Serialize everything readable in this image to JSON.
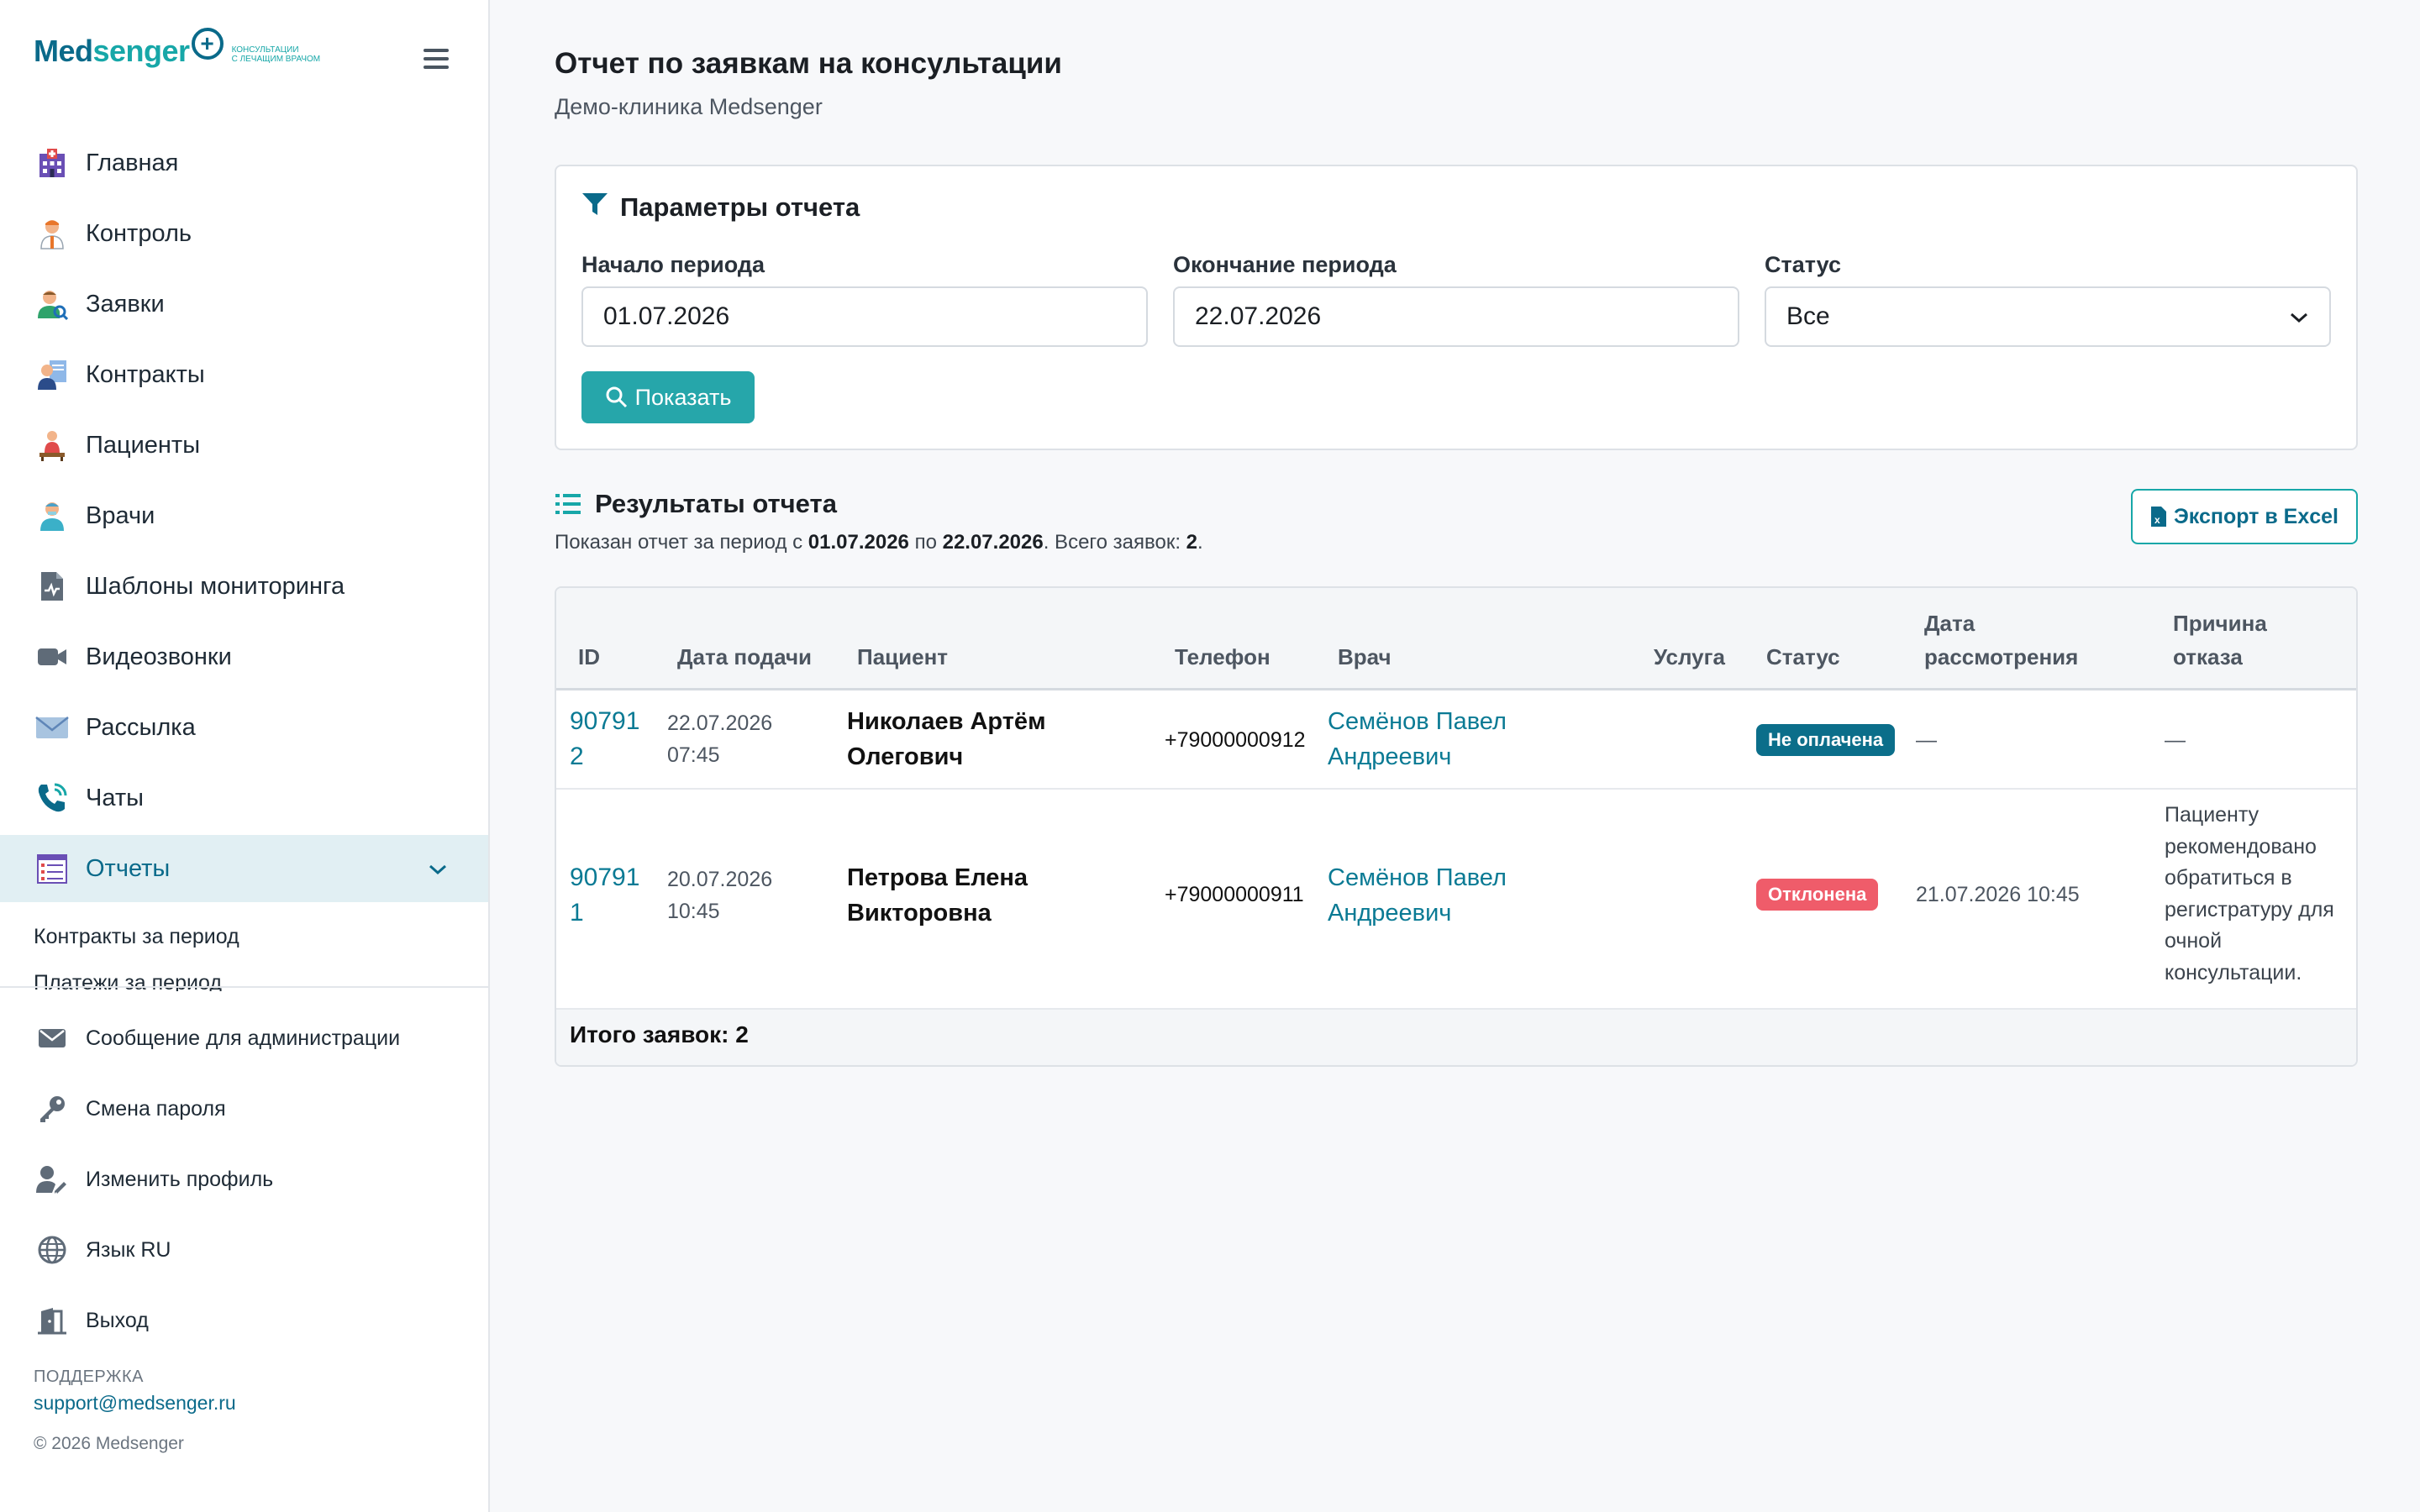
{
  "brand": {
    "name_part1": "Med",
    "name_part2": "senger",
    "tagline_line1": "консультации",
    "tagline_line2": "с лечащим врачом"
  },
  "sidebar": {
    "items": [
      {
        "label": "Главная",
        "icon": "hospital-icon"
      },
      {
        "label": "Контроль",
        "icon": "doctor-icon"
      },
      {
        "label": "Заявки",
        "icon": "user-search-icon"
      },
      {
        "label": "Контракты",
        "icon": "contract-icon"
      },
      {
        "label": "Пациенты",
        "icon": "patient-icon"
      },
      {
        "label": "Врачи",
        "icon": "physician-icon"
      },
      {
        "label": "Шаблоны мониторинга",
        "icon": "template-file-icon"
      },
      {
        "label": "Видеозвонки",
        "icon": "video-camera-icon"
      },
      {
        "label": "Рассылка",
        "icon": "envelope-icon"
      },
      {
        "label": "Чаты",
        "icon": "phone-chat-icon"
      }
    ],
    "active_item": {
      "label": "Отчеты",
      "icon": "report-checklist-icon"
    },
    "sub_items": [
      "Контракты за период",
      "Платежи за период"
    ],
    "bottom_items": [
      {
        "label": "Сообщение для администрации",
        "icon": "envelope-icon"
      },
      {
        "label": "Смена пароля",
        "icon": "key-icon"
      },
      {
        "label": "Изменить профиль",
        "icon": "user-edit-icon"
      },
      {
        "label": "Язык RU",
        "icon": "globe-icon"
      },
      {
        "label": "Выход",
        "icon": "exit-door-icon"
      }
    ],
    "support_label": "ПОДДЕРЖКА",
    "support_email": "support@medsenger.ru",
    "copyright": "© 2026 Medsenger"
  },
  "header": {
    "title": "Отчет по заявкам на консультации",
    "subtitle": "Демо-клиника Medsenger"
  },
  "params": {
    "title": "Параметры отчета",
    "start_label": "Начало периода",
    "start_value": "01.07.2026",
    "end_label": "Окончание периода",
    "end_value": "22.07.2026",
    "status_label": "Статус",
    "status_value": "Все",
    "show_button": "Показать"
  },
  "results": {
    "title": "Результаты отчета",
    "summary_prefix": "Показан отчет за период с ",
    "summary_from": "01.07.2026",
    "summary_mid": " по ",
    "summary_to": "22.07.2026",
    "summary_count_label": ". Всего заявок: ",
    "summary_count": "2",
    "summary_end": ".",
    "export_button": "Экспорт в Excel"
  },
  "table": {
    "headers": {
      "id": "ID",
      "date": "Дата подачи",
      "patient": "Пациент",
      "phone": "Телефон",
      "doctor": "Врач",
      "service": "Услуга",
      "status": "Статус",
      "review_line1": "Дата",
      "review_line2": "рассмотрения",
      "reason_line1": "Причина",
      "reason_line2": "отказа"
    },
    "rows": [
      {
        "id_line1": "90791",
        "id_line2": "2",
        "date_line1": "22.07.2026",
        "date_line2": "07:45",
        "patient_line1": "Николаев Артём",
        "patient_line2": "Олегович",
        "phone": "+79000000912",
        "doctor_line1": "Семёнов Павел",
        "doctor_line2": "Андреевич",
        "service": "",
        "status": "Не оплачена",
        "status_color": "#0b6e8a",
        "review_date": "—",
        "reason": "—"
      },
      {
        "id_line1": "90791",
        "id_line2": "1",
        "date_line1": "20.07.2026",
        "date_line2": "10:45",
        "patient_line1": "Петрова Елена",
        "patient_line2": "Викторовна",
        "phone": "+79000000911",
        "doctor_line1": "Семёнов Павел",
        "doctor_line2": "Андреевич",
        "service": "",
        "status": "Отклонена",
        "status_color": "#ef5c6a",
        "review_date": "21.07.2026 10:45",
        "reason_lines": [
          "Пациенту",
          "рекомендовано",
          "обратиться в",
          "регистратуру для",
          "очной",
          "консультации."
        ]
      }
    ],
    "footer": "Итого заявок: 2"
  },
  "colors": {
    "accent": "#17a7a8",
    "brand_dark": "#0a6a8a",
    "button": "#26a6aa",
    "active_bg": "#e1eff3"
  }
}
